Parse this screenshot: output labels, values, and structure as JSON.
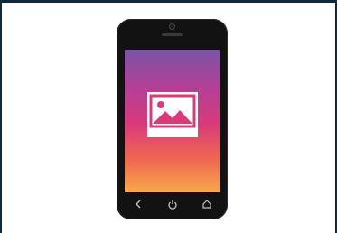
{
  "colors": {
    "background": "#0e2a3f",
    "phone_body": "#121212",
    "screen_gradient": [
      "#7a53a6",
      "#b63f95",
      "#d93a7a",
      "#f06a4f",
      "#f7a94a"
    ],
    "icon": "#ffffff"
  },
  "icons": {
    "screen_icon": "image-placeholder-icon",
    "nav": [
      "back-icon",
      "power-icon",
      "home-icon"
    ]
  }
}
